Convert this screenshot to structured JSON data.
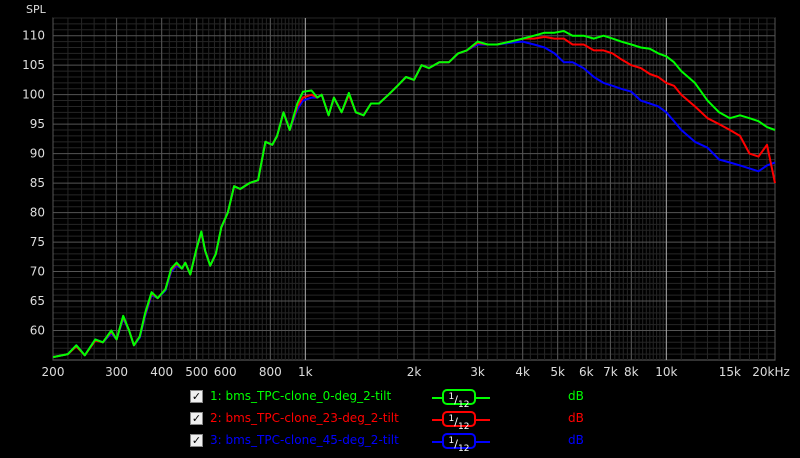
{
  "chart_data": {
    "type": "line",
    "ylabel": "SPL",
    "x_scale": "log",
    "xlim": [
      200,
      20000
    ],
    "ylim": [
      55,
      113
    ],
    "y_ticks": [
      60,
      65,
      70,
      75,
      80,
      85,
      90,
      95,
      100,
      105,
      110
    ],
    "x_ticks": [
      {
        "v": 200,
        "label": "200"
      },
      {
        "v": 300,
        "label": "300"
      },
      {
        "v": 400,
        "label": "400"
      },
      {
        "v": 500,
        "label": "500"
      },
      {
        "v": 600,
        "label": "600"
      },
      {
        "v": 800,
        "label": "800"
      },
      {
        "v": 1000,
        "label": "1k"
      },
      {
        "v": 2000,
        "label": "2k"
      },
      {
        "v": 3000,
        "label": "3k"
      },
      {
        "v": 4000,
        "label": "4k"
      },
      {
        "v": 5000,
        "label": "5k"
      },
      {
        "v": 6000,
        "label": "6k"
      },
      {
        "v": 7000,
        "label": "7k"
      },
      {
        "v": 8000,
        "label": "8k"
      },
      {
        "v": 10000,
        "label": "10k"
      },
      {
        "v": 15000,
        "label": "15k"
      },
      {
        "v": 20000,
        "label": "20kHz"
      }
    ],
    "major_vlines": [
      1000,
      10000
    ],
    "series": [
      {
        "name": "1: bms_TPC-clone_0-deg_2-tilt",
        "color": "#00ff00",
        "points": [
          [
            200,
            55.5
          ],
          [
            220,
            56
          ],
          [
            232,
            57.5
          ],
          [
            245,
            55.8
          ],
          [
            262,
            58.5
          ],
          [
            275,
            58
          ],
          [
            290,
            60
          ],
          [
            300,
            58.5
          ],
          [
            313,
            62.5
          ],
          [
            325,
            60
          ],
          [
            335,
            57.5
          ],
          [
            348,
            59
          ],
          [
            360,
            63
          ],
          [
            375,
            66.5
          ],
          [
            390,
            65.5
          ],
          [
            410,
            67
          ],
          [
            425,
            70.5
          ],
          [
            440,
            71.5
          ],
          [
            455,
            70.5
          ],
          [
            465,
            71.5
          ],
          [
            480,
            69.5
          ],
          [
            500,
            74
          ],
          [
            515,
            76.8
          ],
          [
            528,
            73.5
          ],
          [
            545,
            71
          ],
          [
            565,
            73
          ],
          [
            585,
            77.5
          ],
          [
            610,
            80
          ],
          [
            635,
            84.5
          ],
          [
            660,
            84
          ],
          [
            700,
            85
          ],
          [
            740,
            85.5
          ],
          [
            775,
            92
          ],
          [
            810,
            91.5
          ],
          [
            835,
            93
          ],
          [
            870,
            97
          ],
          [
            905,
            94
          ],
          [
            950,
            98.5
          ],
          [
            985,
            100.5
          ],
          [
            1040,
            100.7
          ],
          [
            1080,
            99.5
          ],
          [
            1110,
            100
          ],
          [
            1160,
            96.5
          ],
          [
            1200,
            99.5
          ],
          [
            1260,
            97
          ],
          [
            1320,
            100.3
          ],
          [
            1380,
            97
          ],
          [
            1450,
            96.5
          ],
          [
            1520,
            98.5
          ],
          [
            1600,
            98.5
          ],
          [
            1700,
            100
          ],
          [
            1800,
            101.5
          ],
          [
            1900,
            103
          ],
          [
            2000,
            102.5
          ],
          [
            2100,
            105
          ],
          [
            2200,
            104.5
          ],
          [
            2350,
            105.5
          ],
          [
            2500,
            105.5
          ],
          [
            2650,
            107
          ],
          [
            2800,
            107.5
          ],
          [
            3000,
            109
          ],
          [
            3200,
            108.5
          ],
          [
            3400,
            108.5
          ],
          [
            3700,
            109
          ],
          [
            4000,
            109.5
          ],
          [
            4300,
            110
          ],
          [
            4600,
            110.5
          ],
          [
            4900,
            110.5
          ],
          [
            5200,
            110.8
          ],
          [
            5500,
            110
          ],
          [
            5900,
            110
          ],
          [
            6300,
            109.5
          ],
          [
            6700,
            110
          ],
          [
            7100,
            109.5
          ],
          [
            7500,
            109
          ],
          [
            8000,
            108.5
          ],
          [
            8500,
            108
          ],
          [
            9000,
            107.8
          ],
          [
            9500,
            107
          ],
          [
            10000,
            106.5
          ],
          [
            10500,
            105.5
          ],
          [
            11000,
            104
          ],
          [
            12000,
            102
          ],
          [
            13000,
            99
          ],
          [
            14000,
            97
          ],
          [
            15000,
            96
          ],
          [
            16000,
            96.5
          ],
          [
            17000,
            96
          ],
          [
            18000,
            95.5
          ],
          [
            19000,
            94.5
          ],
          [
            20000,
            94
          ]
        ]
      },
      {
        "name": "2: bms_TPC-clone_23-deg_2-tilt",
        "color": "#ff0000",
        "points": [
          [
            200,
            55.5
          ],
          [
            220,
            56
          ],
          [
            232,
            57.3
          ],
          [
            245,
            55.8
          ],
          [
            262,
            58.3
          ],
          [
            275,
            58
          ],
          [
            290,
            59.8
          ],
          [
            300,
            58.5
          ],
          [
            313,
            62.3
          ],
          [
            325,
            60
          ],
          [
            335,
            57.5
          ],
          [
            348,
            59
          ],
          [
            360,
            62.8
          ],
          [
            375,
            66.3
          ],
          [
            390,
            65.5
          ],
          [
            410,
            67
          ],
          [
            425,
            70.3
          ],
          [
            440,
            71.3
          ],
          [
            455,
            70.5
          ],
          [
            465,
            71.5
          ],
          [
            480,
            69.5
          ],
          [
            500,
            74
          ],
          [
            515,
            76.6
          ],
          [
            528,
            73.5
          ],
          [
            545,
            71
          ],
          [
            565,
            73
          ],
          [
            585,
            77.5
          ],
          [
            610,
            80
          ],
          [
            635,
            84.5
          ],
          [
            660,
            84
          ],
          [
            700,
            85
          ],
          [
            740,
            85.5
          ],
          [
            775,
            92
          ],
          [
            810,
            91.5
          ],
          [
            835,
            93
          ],
          [
            870,
            97
          ],
          [
            905,
            94
          ],
          [
            950,
            98
          ],
          [
            985,
            99.5
          ],
          [
            1040,
            100
          ],
          [
            1080,
            99.5
          ],
          [
            1110,
            100
          ],
          [
            1160,
            96.5
          ],
          [
            1200,
            99.5
          ],
          [
            1260,
            97
          ],
          [
            1320,
            100
          ],
          [
            1380,
            97
          ],
          [
            1450,
            96.5
          ],
          [
            1520,
            98.5
          ],
          [
            1600,
            98.5
          ],
          [
            1700,
            100
          ],
          [
            1800,
            101.5
          ],
          [
            1900,
            103
          ],
          [
            2000,
            102.5
          ],
          [
            2100,
            105
          ],
          [
            2200,
            104.5
          ],
          [
            2350,
            105.5
          ],
          [
            2500,
            105.5
          ],
          [
            2650,
            107
          ],
          [
            2800,
            107.5
          ],
          [
            3000,
            108.8
          ],
          [
            3200,
            108.5
          ],
          [
            3400,
            108.5
          ],
          [
            3700,
            109
          ],
          [
            4000,
            109.5
          ],
          [
            4300,
            109.5
          ],
          [
            4600,
            109.8
          ],
          [
            4900,
            109.5
          ],
          [
            5200,
            109.5
          ],
          [
            5500,
            108.5
          ],
          [
            5900,
            108.5
          ],
          [
            6300,
            107.5
          ],
          [
            6700,
            107.5
          ],
          [
            7100,
            107
          ],
          [
            7500,
            106
          ],
          [
            8000,
            105
          ],
          [
            8500,
            104.5
          ],
          [
            9000,
            103.5
          ],
          [
            9500,
            103
          ],
          [
            10000,
            102
          ],
          [
            10500,
            101.5
          ],
          [
            11000,
            100
          ],
          [
            12000,
            98
          ],
          [
            13000,
            96
          ],
          [
            14000,
            95
          ],
          [
            15000,
            94
          ],
          [
            16000,
            93
          ],
          [
            17000,
            90
          ],
          [
            18000,
            89.5
          ],
          [
            19000,
            91.5
          ],
          [
            20000,
            85
          ]
        ]
      },
      {
        "name": "3: bms_TPC-clone_45-deg_2-tilt",
        "color": "#0000ff",
        "points": [
          [
            200,
            55.5
          ],
          [
            220,
            56
          ],
          [
            232,
            57.5
          ],
          [
            245,
            55.8
          ],
          [
            262,
            58.5
          ],
          [
            275,
            58
          ],
          [
            290,
            59.5
          ],
          [
            300,
            58.5
          ],
          [
            313,
            62
          ],
          [
            325,
            60
          ],
          [
            335,
            57.5
          ],
          [
            348,
            58.8
          ],
          [
            360,
            62.5
          ],
          [
            375,
            66
          ],
          [
            390,
            65.5
          ],
          [
            410,
            66.8
          ],
          [
            425,
            70
          ],
          [
            440,
            71
          ],
          [
            455,
            70.5
          ],
          [
            465,
            71.5
          ],
          [
            480,
            69.5
          ],
          [
            500,
            74
          ],
          [
            515,
            76.5
          ],
          [
            528,
            73.5
          ],
          [
            545,
            71
          ],
          [
            565,
            73
          ],
          [
            585,
            77.5
          ],
          [
            610,
            80
          ],
          [
            635,
            84.5
          ],
          [
            660,
            84
          ],
          [
            700,
            85
          ],
          [
            740,
            85.5
          ],
          [
            775,
            92
          ],
          [
            810,
            91.5
          ],
          [
            835,
            93
          ],
          [
            870,
            97
          ],
          [
            905,
            94
          ],
          [
            950,
            97.5
          ],
          [
            985,
            99
          ],
          [
            1040,
            99.5
          ],
          [
            1080,
            99.5
          ],
          [
            1110,
            100
          ],
          [
            1160,
            96.5
          ],
          [
            1200,
            99.5
          ],
          [
            1260,
            97
          ],
          [
            1320,
            100
          ],
          [
            1380,
            97
          ],
          [
            1450,
            96.5
          ],
          [
            1520,
            98.5
          ],
          [
            1600,
            98.5
          ],
          [
            1700,
            100
          ],
          [
            1800,
            101.5
          ],
          [
            1900,
            103
          ],
          [
            2000,
            102.5
          ],
          [
            2100,
            105
          ],
          [
            2200,
            104.5
          ],
          [
            2350,
            105.5
          ],
          [
            2500,
            105.5
          ],
          [
            2650,
            107
          ],
          [
            2800,
            107.5
          ],
          [
            3000,
            108.5
          ],
          [
            3200,
            108.5
          ],
          [
            3400,
            108.5
          ],
          [
            3700,
            108.8
          ],
          [
            4000,
            109
          ],
          [
            4300,
            108.5
          ],
          [
            4600,
            108
          ],
          [
            4900,
            107
          ],
          [
            5200,
            105.5
          ],
          [
            5500,
            105.5
          ],
          [
            5900,
            104.5
          ],
          [
            6300,
            103
          ],
          [
            6700,
            102
          ],
          [
            7100,
            101.5
          ],
          [
            7500,
            101
          ],
          [
            8000,
            100.5
          ],
          [
            8500,
            99
          ],
          [
            9000,
            98.5
          ],
          [
            9500,
            98
          ],
          [
            10000,
            97
          ],
          [
            10500,
            95.5
          ],
          [
            11000,
            94
          ],
          [
            12000,
            92
          ],
          [
            13000,
            91
          ],
          [
            14000,
            89
          ],
          [
            15000,
            88.5
          ],
          [
            16000,
            88
          ],
          [
            17000,
            87.5
          ],
          [
            18000,
            87
          ],
          [
            19000,
            88
          ],
          [
            20000,
            88.5
          ]
        ]
      }
    ]
  },
  "legend": {
    "items": [
      {
        "checked": "✓",
        "name": "1: bms_TPC-clone_0-deg_2-tilt",
        "color": "#00ff00",
        "smoothing_num": "1",
        "smoothing_den": "12",
        "unit": "dB"
      },
      {
        "checked": "✓",
        "name": "2: bms_TPC-clone_23-deg_2-tilt",
        "color": "#ff0000",
        "smoothing_num": "1",
        "smoothing_den": "12",
        "unit": "dB"
      },
      {
        "checked": "✓",
        "name": "3: bms_TPC-clone_45-deg_2-tilt",
        "color": "#0000ff",
        "smoothing_num": "1",
        "smoothing_den": "12",
        "unit": "dB"
      }
    ]
  }
}
